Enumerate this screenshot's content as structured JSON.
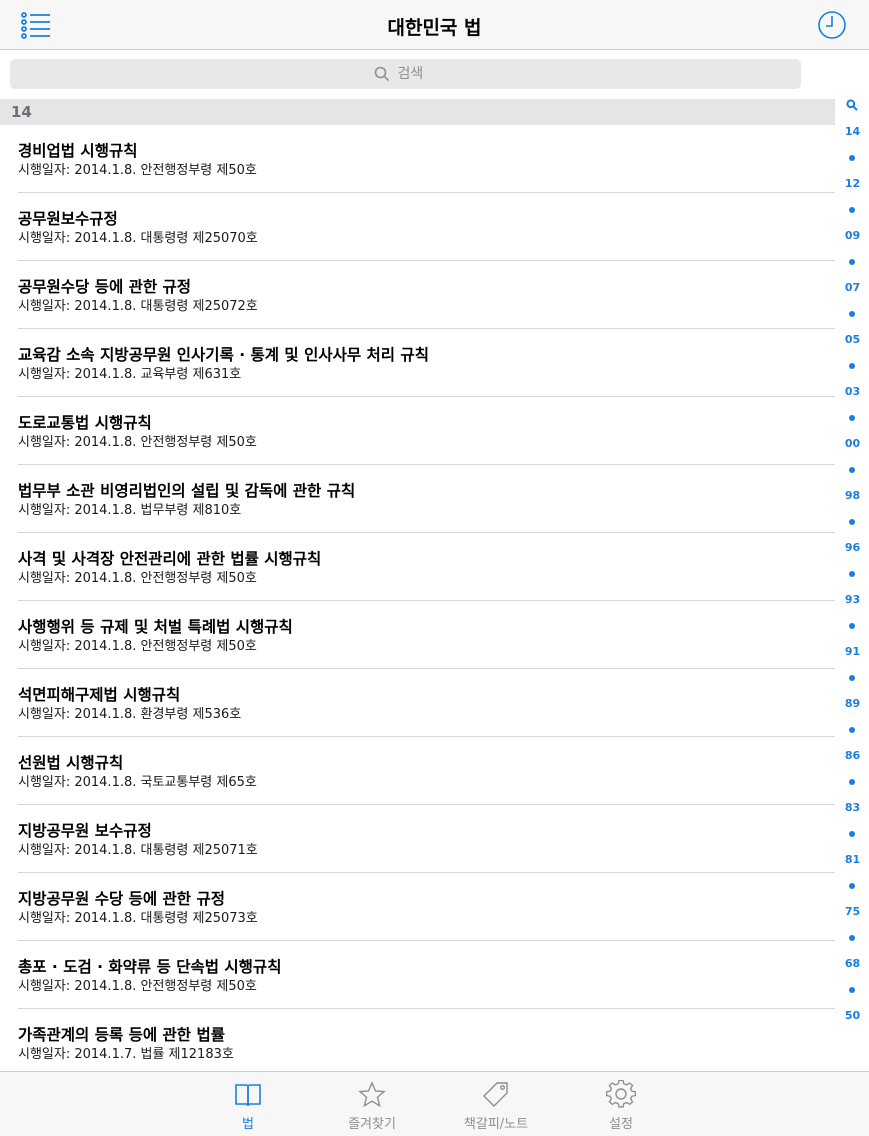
{
  "navbar": {
    "title": "대한민국 법",
    "menu_icon": "list-icon",
    "history_icon": "clock-icon"
  },
  "search": {
    "placeholder": "검색"
  },
  "section": {
    "header": "14"
  },
  "laws": [
    {
      "name": "경비업법 시행규칙",
      "meta": "시행일자: 2014.1.8. 안전행정부령 제50호"
    },
    {
      "name": "공무원보수규정",
      "meta": "시행일자: 2014.1.8. 대통령령 제25070호"
    },
    {
      "name": "공무원수당 등에 관한 규정",
      "meta": "시행일자: 2014.1.8. 대통령령 제25072호"
    },
    {
      "name": "교육감 소속 지방공무원 인사기록 · 통계 및 인사사무 처리 규칙",
      "meta": "시행일자: 2014.1.8. 교육부령 제631호"
    },
    {
      "name": "도로교통법 시행규칙",
      "meta": "시행일자: 2014.1.8. 안전행정부령 제50호"
    },
    {
      "name": "법무부 소관 비영리법인의 설립 및 감독에 관한 규칙",
      "meta": "시행일자: 2014.1.8. 법무부령 제810호"
    },
    {
      "name": "사격 및 사격장 안전관리에 관한 법률 시행규칙",
      "meta": "시행일자: 2014.1.8. 안전행정부령 제50호"
    },
    {
      "name": "사행행위 등 규제 및 처벌 특례법 시행규칙",
      "meta": "시행일자: 2014.1.8. 안전행정부령 제50호"
    },
    {
      "name": "석면피해구제법 시행규칙",
      "meta": "시행일자: 2014.1.8. 환경부령 제536호"
    },
    {
      "name": "선원법 시행규칙",
      "meta": "시행일자: 2014.1.8. 국토교통부령 제65호"
    },
    {
      "name": "지방공무원 보수규정",
      "meta": "시행일자: 2014.1.8. 대통령령 제25071호"
    },
    {
      "name": "지방공무원 수당 등에 관한 규정",
      "meta": "시행일자: 2014.1.8. 대통령령 제25073호"
    },
    {
      "name": "총포 · 도검 · 화약류 등 단속법 시행규칙",
      "meta": "시행일자: 2014.1.8. 안전행정부령 제50호"
    },
    {
      "name": "가족관계의 등록 등에 관한 법률",
      "meta": "시행일자: 2014.1.7. 법률 제12183호"
    }
  ],
  "index": {
    "search_icon": "search-icon",
    "labels": [
      "14",
      "12",
      "09",
      "07",
      "05",
      "03",
      "00",
      "98",
      "96",
      "93",
      "91",
      "89",
      "86",
      "83",
      "81",
      "75",
      "68",
      "50"
    ]
  },
  "tabs": [
    {
      "label": "법",
      "icon": "book-icon",
      "active": true
    },
    {
      "label": "즐겨찾기",
      "icon": "star-icon",
      "active": false
    },
    {
      "label": "책갈피/노트",
      "icon": "tag-icon",
      "active": false
    },
    {
      "label": "설정",
      "icon": "gear-icon",
      "active": false
    }
  ],
  "colors": {
    "accent": "#1b7fe0",
    "inactive": "#8e8e93"
  }
}
